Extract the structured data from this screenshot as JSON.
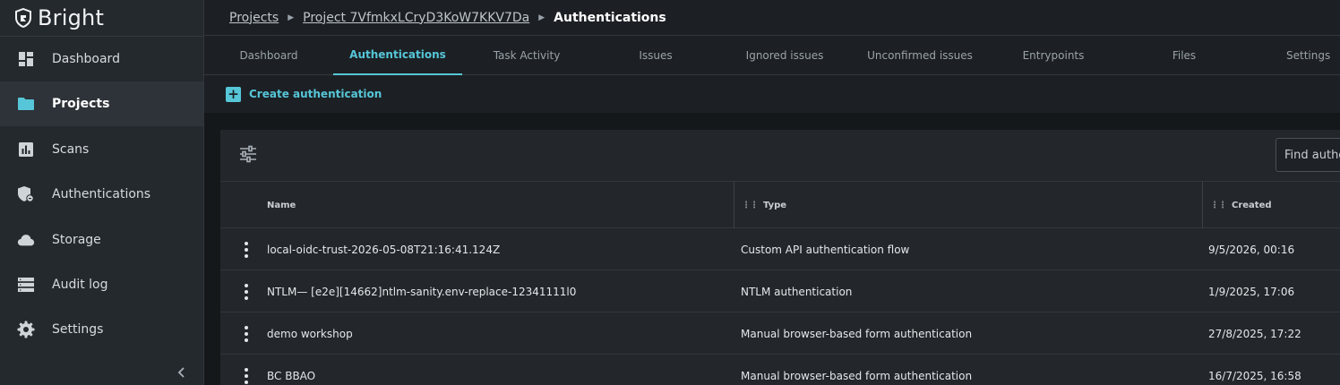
{
  "app": {
    "brand": "Bright"
  },
  "sidebar": {
    "items": [
      {
        "label": "Dashboard",
        "icon": "dashboard-icon",
        "active": false
      },
      {
        "label": "Projects",
        "icon": "folder-icon",
        "active": true
      },
      {
        "label": "Scans",
        "icon": "scans-chart-icon",
        "active": false
      },
      {
        "label": "Authentications",
        "icon": "shield-auth-icon",
        "active": false
      },
      {
        "label": "Storage",
        "icon": "cloud-icon",
        "active": false
      },
      {
        "label": "Audit log",
        "icon": "list-icon",
        "active": false
      },
      {
        "label": "Settings",
        "icon": "gear-icon",
        "active": false
      }
    ],
    "collapse_icon": "chevron-left-icon"
  },
  "breadcrumb": {
    "root": "Projects",
    "project": "Project 7VfmkxLCryD3KoW7KKV7Da",
    "current": "Authentications"
  },
  "tabs": [
    {
      "label": "Dashboard",
      "active": false
    },
    {
      "label": "Authentications",
      "active": true
    },
    {
      "label": "Task Activity",
      "active": false
    },
    {
      "label": "Issues",
      "active": false
    },
    {
      "label": "Ignored issues",
      "active": false
    },
    {
      "label": "Unconfirmed issues",
      "active": false
    },
    {
      "label": "Entrypoints",
      "active": false
    },
    {
      "label": "Files",
      "active": false
    },
    {
      "label": "Settings",
      "active": false
    }
  ],
  "toolbar": {
    "create_label": "Create authentication"
  },
  "search": {
    "placeholder": "Find authentication"
  },
  "table": {
    "columns": [
      "Name",
      "Type",
      "Created"
    ],
    "rows": [
      {
        "name": "local-oidc-trust-2026-05-08T21:16:41.124Z",
        "type": "Custom API authentication flow",
        "created": "9/5/2026, 00:16"
      },
      {
        "name": "NTLM— [e2e][14662]ntlm-sanity.env-replace-12341111l0",
        "type": "NTLM authentication",
        "created": "1/9/2025, 17:06"
      },
      {
        "name": "demo workshop",
        "type": "Manual browser-based form authentication",
        "created": "27/8/2025, 17:22"
      },
      {
        "name": "BC BBAO",
        "type": "Manual browser-based form authentication",
        "created": "16/7/2025, 16:58"
      }
    ]
  },
  "colors": {
    "accent": "#56c6d8",
    "background": "#1c2024",
    "sidebar": "#24292e"
  }
}
